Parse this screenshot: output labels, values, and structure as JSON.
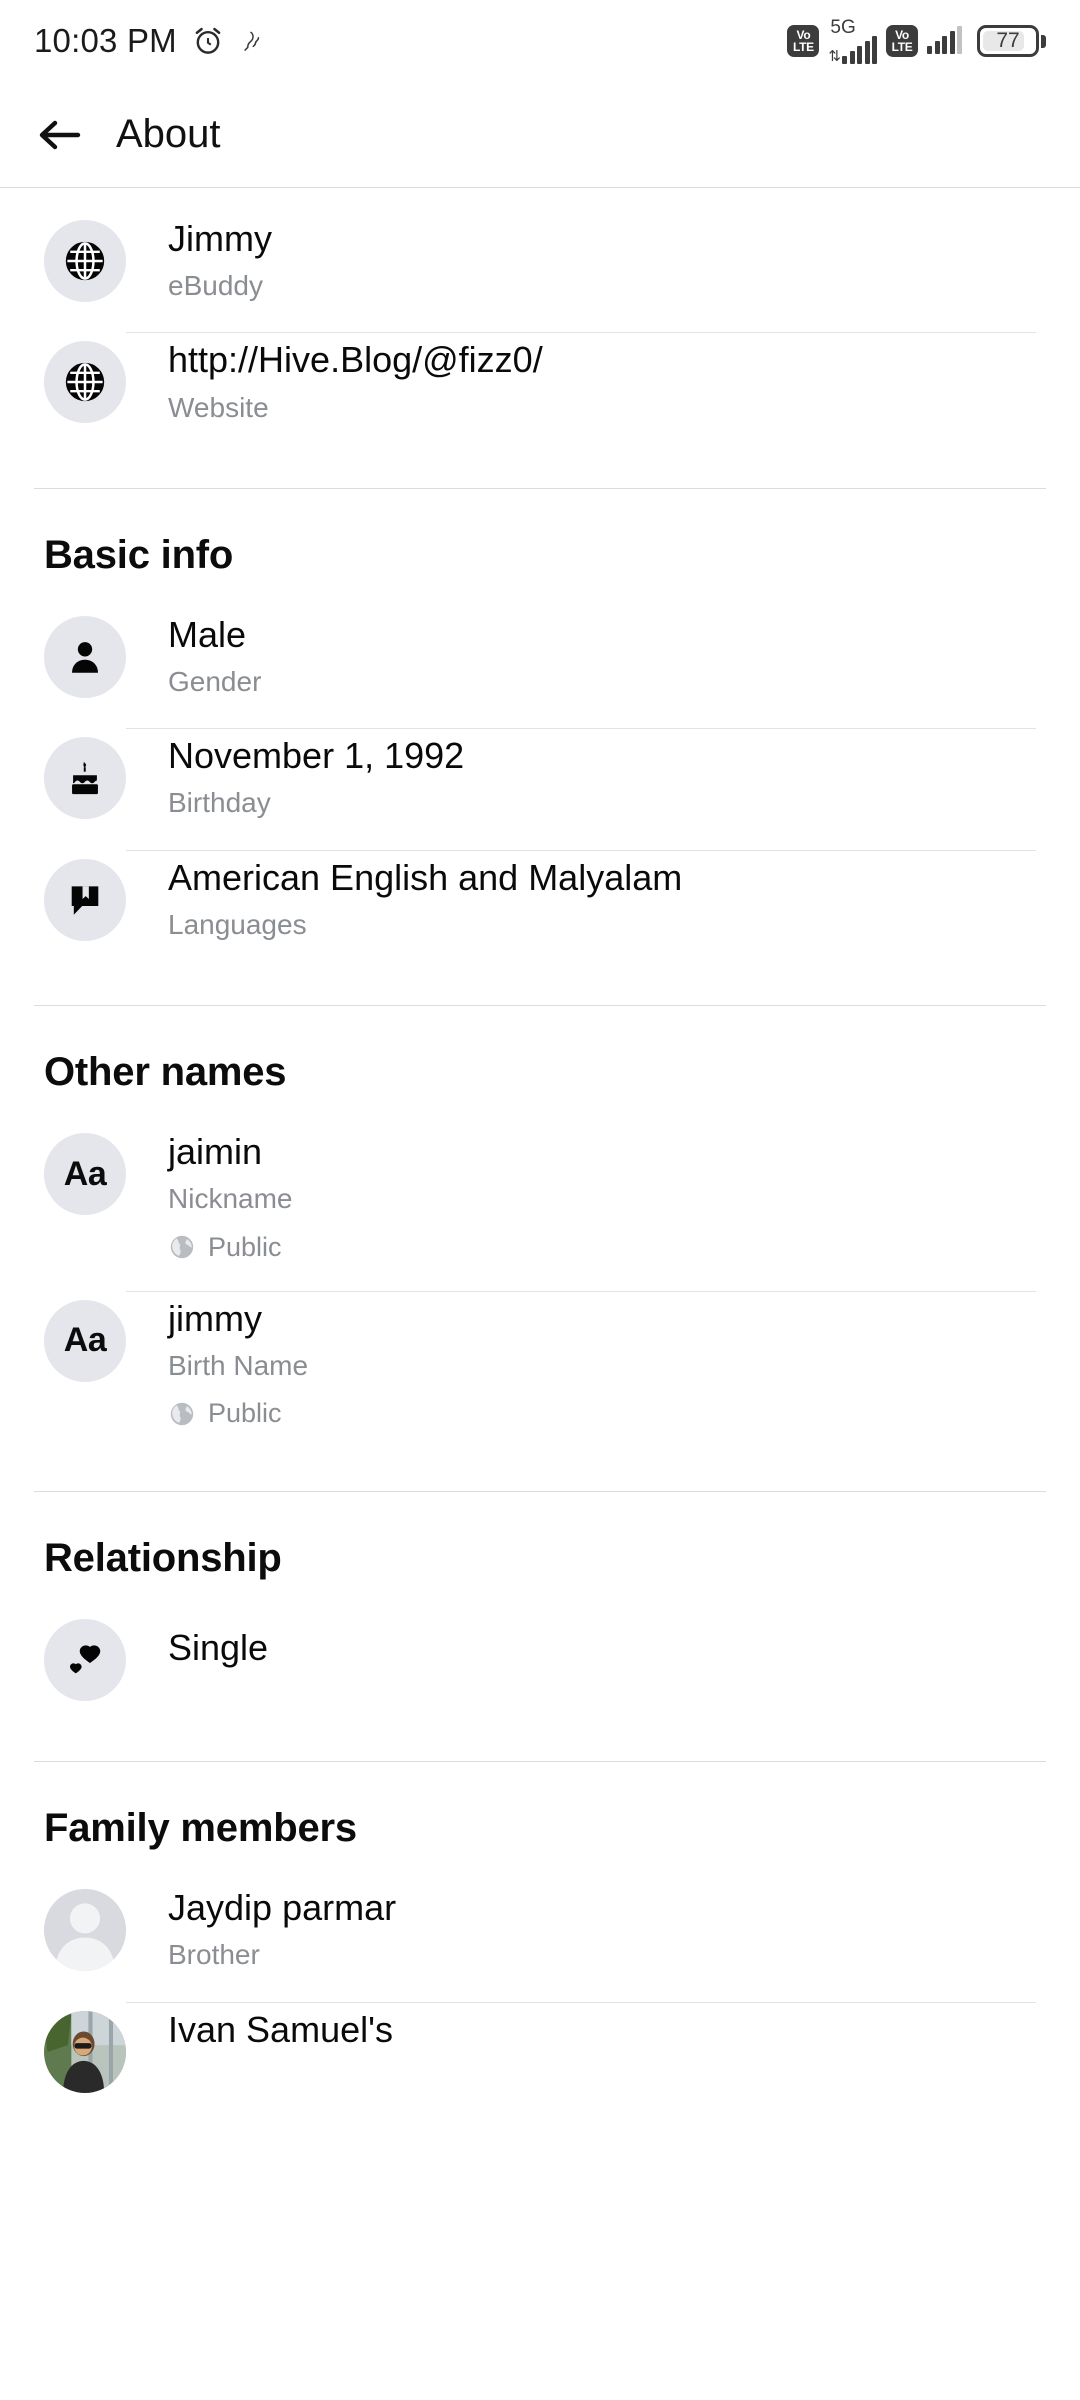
{
  "status_bar": {
    "time": "10:03 PM",
    "alarm_icon": "alarm-icon",
    "secondary_icon": "do-not-disturb-icon",
    "sim1_volte": {
      "top": "Vo",
      "bottom": "LTE"
    },
    "network_type": "5G",
    "sim2_volte": {
      "top": "Vo",
      "bottom": "LTE"
    },
    "battery_level": "77"
  },
  "app_bar": {
    "back_label": "back-arrow",
    "title": "About"
  },
  "sections": [
    {
      "id": "contact-info",
      "title": "",
      "rows": [
        {
          "icon": "globe-icon",
          "title": "Jimmy",
          "subtitle": "eBuddy",
          "privacy": ""
        },
        {
          "icon": "globe-icon",
          "title": "http://Hive.Blog/@fizz0/",
          "subtitle": "Website",
          "privacy": ""
        }
      ]
    },
    {
      "id": "basic-info",
      "title": "Basic info",
      "rows": [
        {
          "icon": "person-icon",
          "title": "Male",
          "subtitle": "Gender",
          "privacy": ""
        },
        {
          "icon": "cake-icon",
          "title": "November 1, 1992",
          "subtitle": "Birthday",
          "privacy": ""
        },
        {
          "icon": "speech-bubble-icon",
          "title": "American English and Malyalam",
          "subtitle": "Languages",
          "privacy": ""
        }
      ]
    },
    {
      "id": "other-names",
      "title": "Other names",
      "rows": [
        {
          "icon": "aa-icon",
          "title": "jaimin",
          "subtitle": "Nickname",
          "privacy": "Public"
        },
        {
          "icon": "aa-icon",
          "title": "jimmy",
          "subtitle": "Birth Name",
          "privacy": "Public"
        }
      ]
    },
    {
      "id": "relationship",
      "title": "Relationship",
      "rows": [
        {
          "icon": "hearts-icon",
          "title": "Single",
          "subtitle": "",
          "privacy": ""
        }
      ]
    },
    {
      "id": "family-members",
      "title": "Family members",
      "rows": [
        {
          "icon": "avatar-silhouette",
          "title": "Jaydip parmar",
          "subtitle": "Brother",
          "privacy": ""
        },
        {
          "icon": "avatar-photo",
          "title": "Ivan Samuel's",
          "subtitle": "",
          "privacy": ""
        }
      ]
    }
  ],
  "colors": {
    "background": "#ffffff",
    "primary_text": "#0a0a0a",
    "secondary_text": "#8a8d91",
    "avatar_bg": "#e4e6eb",
    "divider": "#e2e2e2",
    "section_divider": "#dcdcdc"
  }
}
